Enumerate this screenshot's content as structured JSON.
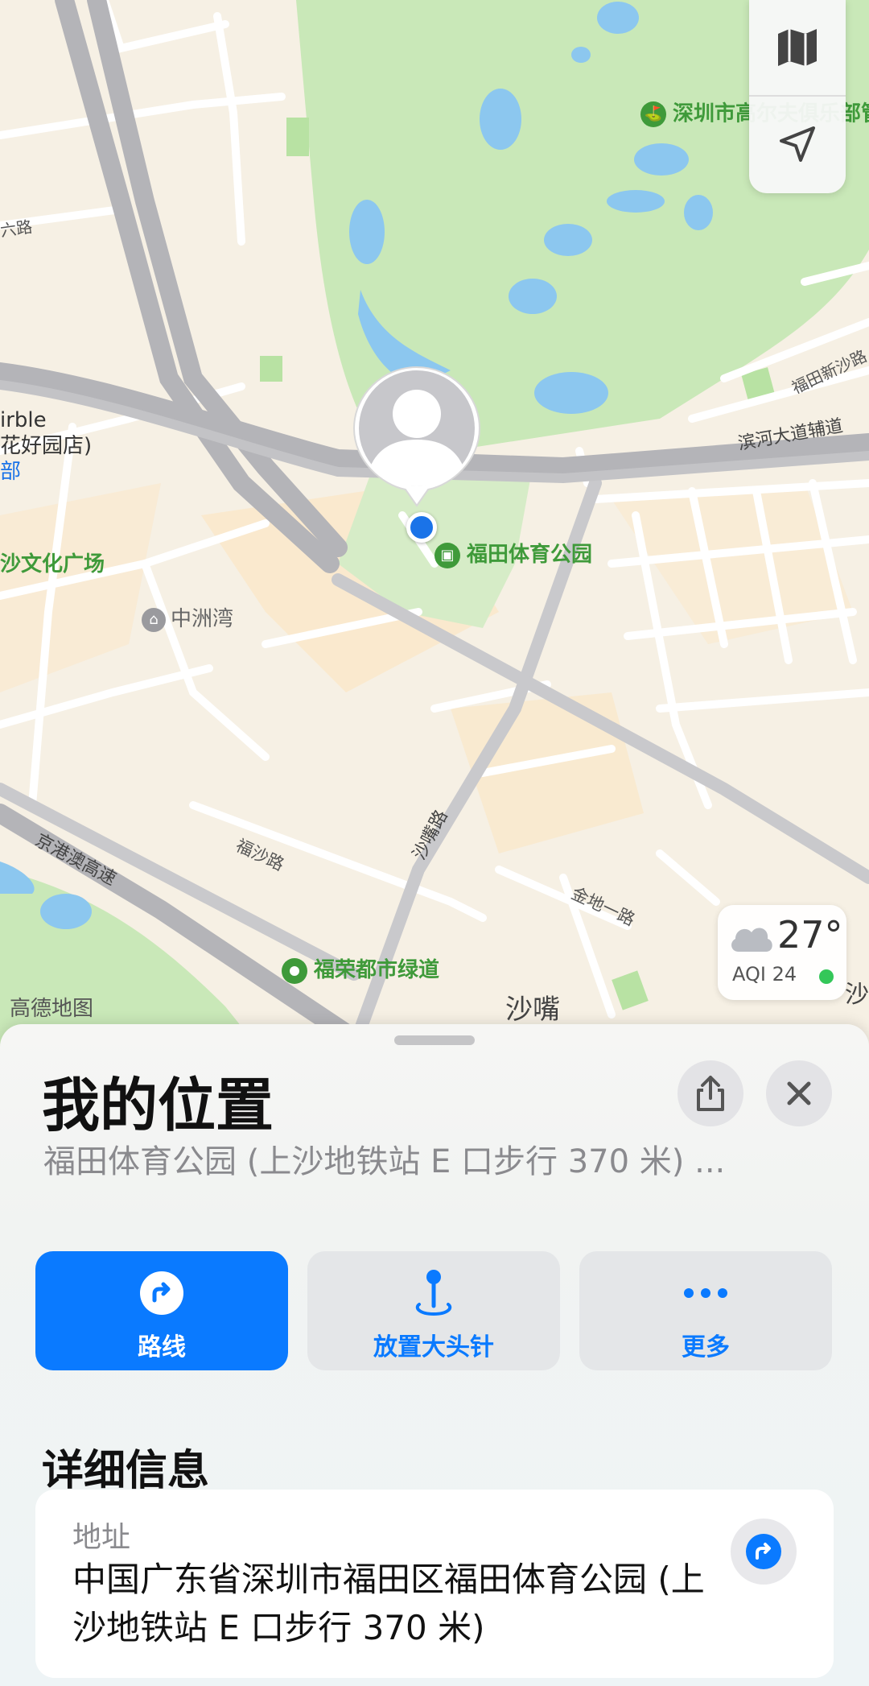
{
  "map": {
    "labels": {
      "club": "深圳市高尔夫俱乐部管理",
      "binhe_aux": "滨河大道辅道",
      "futian_new_road": "福田新沙路",
      "futian_sports_park": "福田体育公园",
      "zhongzhouwan": "中洲湾",
      "culture_square": "沙文化广场",
      "birble": "irble",
      "flower_store": "花好园店)",
      "bu": "部",
      "liu_road": "六路",
      "jinggangao": "京港澳高速",
      "fusha_road": "福沙路",
      "shazui_road": "沙嘴路",
      "jindi_road": "金地一路",
      "furong_greenway": "福荣都市绿道",
      "shazui": "沙嘴",
      "amap": "高德地图",
      "wen": "沙文"
    },
    "weather": {
      "temperature": "27°",
      "aqi": "AQI 24"
    },
    "colors": {
      "park": "#c9e8b8",
      "water": "#8cc7ef",
      "road": "#ffffff",
      "highway": "#b4b4b8",
      "user_dot": "#1a73e8"
    }
  },
  "sheet": {
    "title": "我的位置",
    "subtitle": "福田体育公园 (上沙地铁站 E 口步行 370 米) ...",
    "share_icon": "share-icon",
    "close_icon": "close-icon",
    "actions": [
      {
        "label": "路线",
        "icon": "directions-icon",
        "primary": true
      },
      {
        "label": "放置大头针",
        "icon": "pin-icon",
        "primary": false
      },
      {
        "label": "更多",
        "icon": "ellipsis-icon",
        "primary": false
      }
    ],
    "details_title": "详细信息",
    "address": {
      "label": "地址",
      "value": "中国广东省深圳市福田区福田体育公园 (上沙地铁站 E 口步行 370 米)"
    },
    "accent_color": "#0a7aff"
  }
}
